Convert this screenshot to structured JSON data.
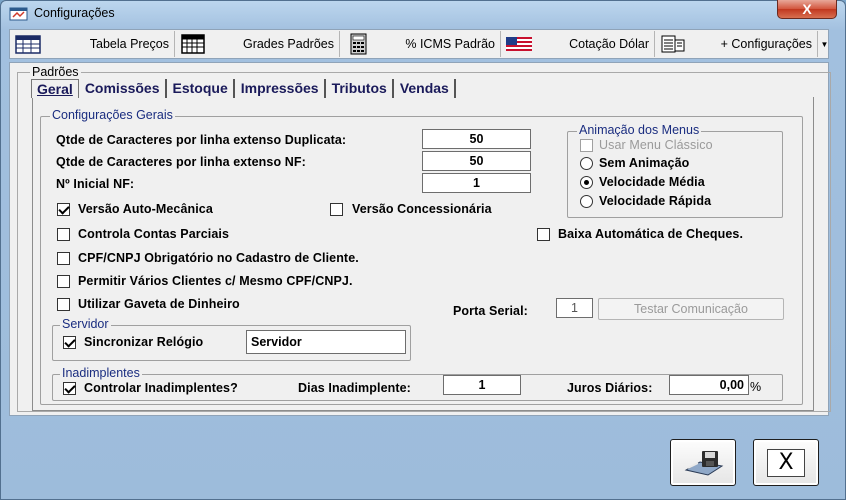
{
  "window": {
    "title": "Configurações",
    "close_label": "X"
  },
  "toolbar": {
    "buttons": [
      {
        "label": "Tabela Preços",
        "icon": "table-icon"
      },
      {
        "label": "Grades Padrões",
        "icon": "grid-icon"
      },
      {
        "label": "% ICMS Padrão",
        "icon": "calculator-icon"
      },
      {
        "label": "Cotação Dólar",
        "icon": "us-flag-icon"
      },
      {
        "label": "+ Configurações",
        "icon": "settings-list-icon"
      }
    ],
    "dropdown_icon": "chevron-down-icon"
  },
  "padroes": {
    "label": "Padrões",
    "tabs": [
      "Geral",
      "Comissões",
      "Estoque",
      "Impressões",
      "Tributos",
      "Vendas"
    ],
    "active_tab": "Geral"
  },
  "config_gerais": {
    "legend": "Configurações Gerais",
    "duplicata_label": "Qtde de Caracteres por linha extenso Duplicata:",
    "duplicata_value": "50",
    "nf_label": "Qtde de Caracteres por linha extenso NF:",
    "nf_value": "50",
    "inicial_nf_label": "Nº Inicial NF:",
    "inicial_nf_value": "1",
    "versao_auto": {
      "label": "Versão Auto-Mecânica",
      "checked": true
    },
    "versao_conc": {
      "label": "Versão Concessionária",
      "checked": false
    },
    "contas_parciais": {
      "label": "Controla Contas Parciais",
      "checked": false
    },
    "baixa_cheques": {
      "label": "Baixa Automática de Cheques.",
      "checked": false
    },
    "cpf_obrigatorio": {
      "label": "CPF/CNPJ Obrigatório no Cadastro de Cliente.",
      "checked": false
    },
    "varios_clientes": {
      "label": "Permitir Vários Clientes c/ Mesmo CPF/CNPJ.",
      "checked": false
    },
    "gaveta": {
      "label": "Utilizar Gaveta de Dinheiro",
      "checked": false
    },
    "porta_serial_label": "Porta Serial:",
    "porta_serial_value": "1",
    "testar_label": "Testar Comunicação"
  },
  "animacao": {
    "legend": "Animação dos Menus",
    "menu_classico": {
      "label": "Usar Menu Clássico",
      "checked": false,
      "disabled": true
    },
    "options": [
      {
        "label": "Sem Animação",
        "checked": false
      },
      {
        "label": "Velocidade Média",
        "checked": true
      },
      {
        "label": "Velocidade Rápida",
        "checked": false
      }
    ]
  },
  "servidor": {
    "legend": "Servidor",
    "sync": {
      "label": "Sincronizar Relógio",
      "checked": true
    },
    "name_value": "Servidor"
  },
  "inadimplentes": {
    "legend": "Inadimplentes",
    "controlar": {
      "label": "Controlar Inadimplentes?",
      "checked": true
    },
    "dias_label": "Dias Inadimplente:",
    "dias_value": "1",
    "juros_label": "Juros Diários:",
    "juros_value": "0,00",
    "percent": "%"
  },
  "footer": {
    "save_icon": "floppy-save-icon",
    "close_icon": "close-x-icon",
    "close_glyph": "X"
  }
}
